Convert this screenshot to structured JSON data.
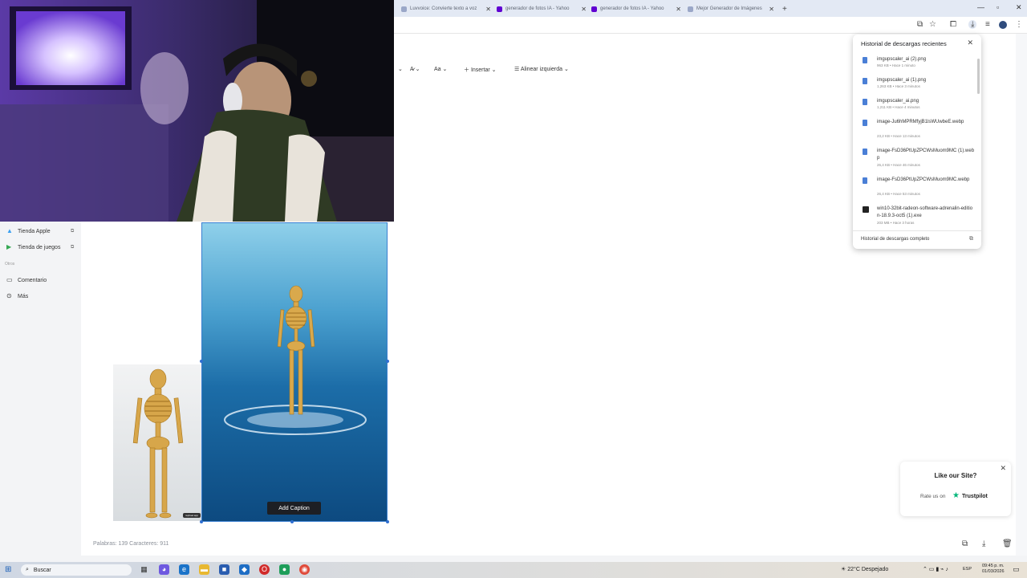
{
  "browser": {
    "tabs": [
      {
        "label": "Luvvoice: Convierte texto a voz",
        "icon": "tab-favicon-luvvoice",
        "color": "#9aa7c8"
      },
      {
        "label": "generador de fotos IA - Yahoo",
        "icon": "tab-favicon-yahoo",
        "color": "#6001d2"
      },
      {
        "label": "generador de fotos IA - Yahoo",
        "icon": "tab-favicon-yahoo",
        "color": "#6001d2"
      },
      {
        "label": "Mejor Generador de Imágenes",
        "icon": "tab-favicon-site",
        "color": "#9aa7c8"
      }
    ],
    "new_tab": "+"
  },
  "formatbar": {
    "font_size": "Aa",
    "insert": "Insertar",
    "align": "Alinear izquierda"
  },
  "sidebar": {
    "items": [
      {
        "label": "Tienda Apple",
        "icon": "apple-store-icon"
      },
      {
        "label": "Tienda de juegos",
        "icon": "play-store-icon"
      }
    ],
    "section": "Otros",
    "other_items": [
      {
        "label": "Comentario",
        "icon": "comment-icon"
      },
      {
        "label": "Más",
        "icon": "more-icon"
      }
    ]
  },
  "document": {
    "caption_button": "Add Caption",
    "watermark": "raphael.app",
    "word_count": "Palabras: 139  Caracteres: 911"
  },
  "downloads": {
    "title": "Historial de descargas recientes",
    "items": [
      {
        "name": "imgupscaler_ai (2).png",
        "meta": "963 KB • Hace 1 minuto"
      },
      {
        "name": "imgupscaler_ai (1).png",
        "meta": "1,263 KB • Hace 3 minutos"
      },
      {
        "name": "imgupscaler_ai.png",
        "meta": "1,211 KB • Hace 4 minutos"
      },
      {
        "name": "image-Ju6hMPRMfyjB1lsWUwbeE.webp",
        "meta": "23,2 KB • Hace 13 minutos"
      },
      {
        "name": "image-FsD36PtUpZPCWsMuom9MC (1).webp",
        "meta": "26,4 KB • Hace 46 minutos"
      },
      {
        "name": "image-FsD36PtUpZPCWsMuom9MC.webp",
        "meta": "26,4 KB • Hace 53 minutos"
      },
      {
        "name": "win10-32bit-radeon-software-adrenalin-edition-18.9.3-oct5 (1).exe",
        "meta": "203 MB • Hace 3 horas"
      }
    ],
    "full_history": "Historial de descargas completo"
  },
  "trustpilot": {
    "title": "Like our Site?",
    "rate": "Rate us on",
    "brand": "Trustpilot"
  },
  "taskbar": {
    "search": "Buscar",
    "weather": "22°C  Despejado",
    "lang": "ESP",
    "time": "09:45 p. m.",
    "date": "01/03/2026"
  }
}
